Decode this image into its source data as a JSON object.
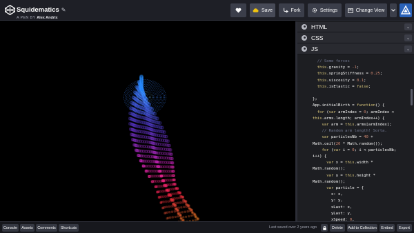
{
  "header": {
    "title": "Squidematics",
    "byline_prefix": "A PEN BY",
    "author": "Alex Andrix",
    "buttons": {
      "save": "Save",
      "fork": "Fork",
      "settings": "Settings",
      "change_view": "Change View"
    }
  },
  "editors": [
    {
      "label": "HTML",
      "collapsed": true
    },
    {
      "label": "CSS",
      "collapsed": true
    },
    {
      "label": "JS",
      "collapsed": false
    }
  ],
  "code": {
    "lines": [
      "  // Some forces",
      "  this.gravity = -1;",
      "  this.springStiffness = 0.25;",
      "  this.viscosity = 0.1;",
      "  this.isElastic = false;",
      "",
      "};",
      "App.initialBirth = function() {",
      "  for (var armIndex = 0; armIndex <",
      "this.arms.length; armIndex++) {",
      "    var arm = this.arms[armIndex];",
      "    // Random arm length! Sorta.",
      "    var particlesNb = 40 +",
      "Math.ceil(20 * Math.random());",
      "    for (var i = 0; i < particlesNb;",
      "i++) {",
      "      var x = this.width *",
      "Math.random();",
      "      var y = this.height *",
      "Math.random();",
      "      var particle = {",
      "        x: x,",
      "        y: y,",
      "        xLast: x,",
      "        yLast: y,",
      "        xSpeed: 0,"
    ]
  },
  "footer": {
    "console": "Console",
    "assets": "Assets",
    "comments": "Comments",
    "shortcuts": "Shortcuts",
    "saved": "Last saved over 2 years ago",
    "delete": "Delete",
    "add_collection": "Add to Collection",
    "embed": "Embed",
    "export": "Export"
  },
  "colors": {
    "header_bg": "#1e1f26",
    "button_bg": "#3b3e4a",
    "editor_bg": "#1d1e22",
    "keyword": "#ddca7e",
    "comment": "#717790",
    "number": "#d08770",
    "avatar": "#2a62b8"
  },
  "icons": [
    "codepen-logo-icon",
    "pencil-icon",
    "heart-icon",
    "cloud-icon",
    "fork-icon",
    "gear-icon",
    "layout-icon",
    "chevron-down-icon",
    "lock-icon"
  ]
}
